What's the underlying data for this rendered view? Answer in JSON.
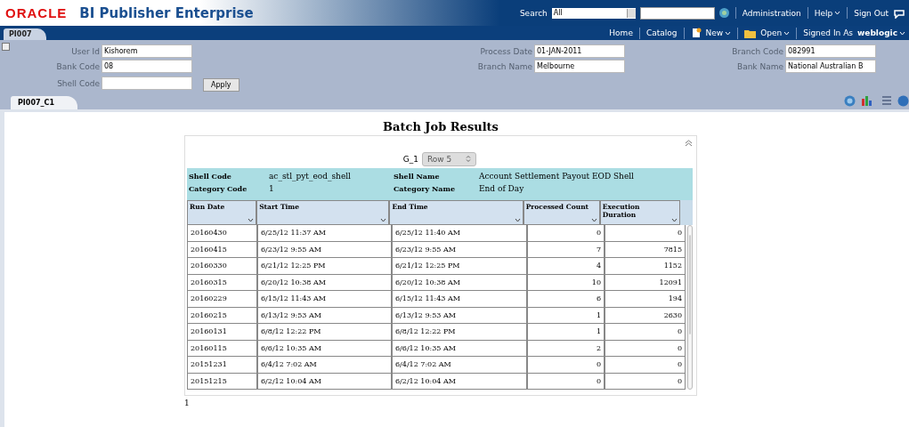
{
  "header": {
    "logo": "ORACLE",
    "product": "BI Publisher Enterprise",
    "search_label": "Search",
    "search_scope": "All",
    "links": [
      "Administration",
      "Help",
      "Sign Out"
    ]
  },
  "nav": {
    "tab": "PI007",
    "links": [
      {
        "kind": "link",
        "label": "Home"
      },
      {
        "kind": "link",
        "label": "Catalog"
      },
      {
        "kind": "menu",
        "label": "New"
      },
      {
        "kind": "menu",
        "label": "Open"
      }
    ],
    "signed_in_label": "Signed In As",
    "user": "weblogic"
  },
  "parameters": [
    {
      "label": "User Id",
      "value": "Kishorem"
    },
    {
      "label": "Bank Code",
      "value": "08"
    },
    {
      "label": "Shell Code"
    },
    {
      "label": "Process Date",
      "value": "01-JAN-2011"
    },
    {
      "label": "Branch Name",
      "value": "Melbourne"
    },
    {
      "label": "Branch Code",
      "value": "082991"
    },
    {
      "label": "Bank Name",
      "value": "National Australian B"
    }
  ],
  "apply_button": "Apply",
  "report_tab": "PI007_C1",
  "report": {
    "title": "Batch Job Results",
    "group_label": "G_1",
    "group_value": "Row 5",
    "summary": [
      {
        "label": "Shell Code",
        "value": "ac_stl_pyt_eod_shell"
      },
      {
        "label": "Shell Name",
        "value": "Account Settlement Payout EOD Shell"
      },
      {
        "label": "Category Code",
        "value": "1"
      },
      {
        "label": "Category Name",
        "value": "End of Day"
      }
    ],
    "columns": [
      "Run Date",
      "Start Time",
      "End Time",
      "Processed Count",
      "Execution Duration"
    ],
    "rows": [
      [
        "20160430",
        "6/25/12 11:37 AM",
        "6/25/12 11:40 AM",
        "0",
        "0"
      ],
      [
        "20160415",
        "6/23/12 9:55 AM",
        "6/23/12 9:55 AM",
        "7",
        "7815"
      ],
      [
        "20160330",
        "6/21/12 12:25 PM",
        "6/21/12 12:25 PM",
        "4",
        "1152"
      ],
      [
        "20160315",
        "6/20/12 10:38 AM",
        "6/20/12 10:38 AM",
        "10",
        "12091"
      ],
      [
        "20160229",
        "6/15/12 11:43 AM",
        "6/15/12 11:43 AM",
        "6",
        "194"
      ],
      [
        "20160215",
        "6/13/12 9:53 AM",
        "6/13/12 9:53 AM",
        "1",
        "2630"
      ],
      [
        "20160131",
        "6/8/12 12:22 PM",
        "6/8/12 12:22 PM",
        "1",
        "0"
      ],
      [
        "20160115",
        "6/6/12 10:35 AM",
        "6/6/12 10:35 AM",
        "2",
        "0"
      ],
      [
        "20151231",
        "6/4/12 7:02 AM",
        "6/4/12 7:02 AM",
        "0",
        "0"
      ],
      [
        "20151215",
        "6/2/12 10:04 AM",
        "6/2/12 10:04 AM",
        "0",
        "0"
      ]
    ],
    "page": "1"
  }
}
